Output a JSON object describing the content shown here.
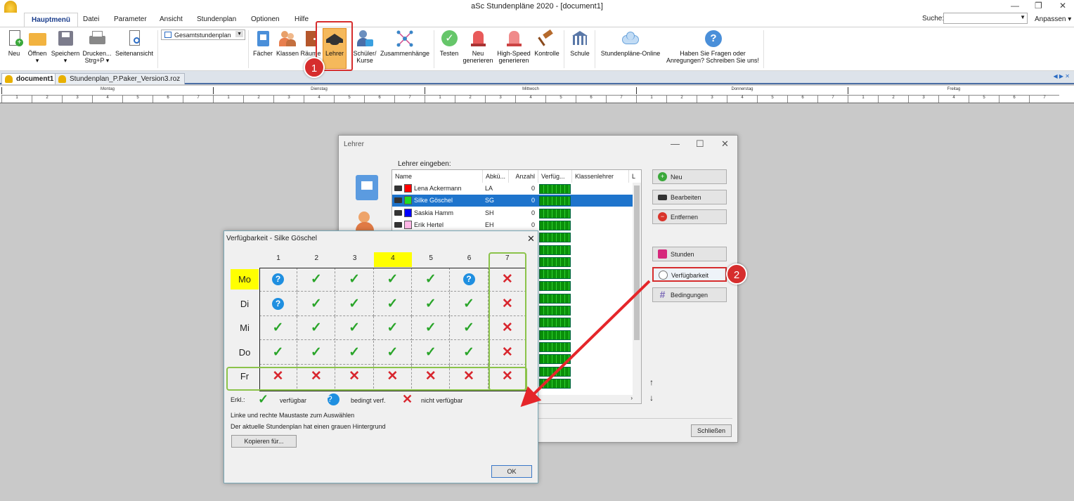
{
  "window": {
    "title": "aSc Stundenpläne 2020  - [document1]"
  },
  "menu": {
    "tabs": [
      "Hauptmenü",
      "Datei",
      "Parameter",
      "Ansicht",
      "Stundenplan",
      "Optionen",
      "Hilfe"
    ],
    "search_label": "Suche:",
    "customize": "Anpassen"
  },
  "ribbon": {
    "neu": "Neu",
    "oeffnen": "Öffnen",
    "speichern": "Speichern",
    "drucken": "Drucken...",
    "drucken2": "Strg+P",
    "seitenansicht": "Seitenansicht",
    "view_select": "Gesamtstundenplan",
    "faecher": "Fächer",
    "klassen": "Klassen",
    "raeume": "Räume",
    "lehrer": "Lehrer",
    "schueler": "Schüler/",
    "kurse": "Kurse",
    "zusammenhaenge": "Zusammenhänge",
    "testen": "Testen",
    "neu_gen": "Neu",
    "neu_gen2": "generieren",
    "highspeed": "High-Speed",
    "highspeed2": "generieren",
    "kontrolle": "Kontrolle",
    "schule": "Schule",
    "online": "Stundenpläne-Online",
    "fragen": "Haben Sie Fragen oder",
    "fragen2": "Anregungen? Schreiben Sie uns!"
  },
  "doc_tabs": [
    "document1",
    "Stundenplan_P.Paker_Version3.roz"
  ],
  "timetable": {
    "days": [
      "Montag",
      "Dienstag",
      "Mittwoch",
      "Donnerstag",
      "Freitag"
    ],
    "periods": [
      "1",
      "2",
      "3",
      "4",
      "5",
      "6",
      "7"
    ]
  },
  "lehrer_dialog": {
    "title": "Lehrer",
    "label": "Lehrer eingeben:",
    "columns": [
      "Name",
      "Abkü...",
      "Anzahl",
      "Verfüg...",
      "Klassenlehrer",
      "L"
    ],
    "rows": [
      {
        "name": "Lena Ackermann",
        "abbr": "LA",
        "count": "0",
        "color": "#ff0000"
      },
      {
        "name": "Silke Göschel",
        "abbr": "SG",
        "count": "0",
        "color": "#22dd22"
      },
      {
        "name": "Saskia Hamm",
        "abbr": "SH",
        "count": "0",
        "color": "#0000ff"
      },
      {
        "name": "Erik Hertel",
        "abbr": "EH",
        "count": "0",
        "color": "#ffb6e6"
      }
    ],
    "buttons": {
      "neu": "Neu",
      "bearbeiten": "Bearbeiten",
      "entfernen": "Entfernen",
      "stunden": "Stunden",
      "verfuegbarkeit": "Verfügbarkeit",
      "bedingungen": "Bedingungen",
      "schliessen": "Schließen"
    }
  },
  "verf_dialog": {
    "title": "Verfügbarkeit - Silke Göschel",
    "periods": [
      "1",
      "2",
      "3",
      "4",
      "5",
      "6",
      "7"
    ],
    "days": [
      "Mo",
      "Di",
      "Mi",
      "Do",
      "Fr"
    ],
    "grid": [
      [
        "q",
        "ok",
        "ok",
        "ok",
        "ok",
        "q",
        "no"
      ],
      [
        "q",
        "ok",
        "ok",
        "ok",
        "ok",
        "ok",
        "no"
      ],
      [
        "ok",
        "ok",
        "ok",
        "ok",
        "ok",
        "ok",
        "no"
      ],
      [
        "ok",
        "ok",
        "ok",
        "ok",
        "ok",
        "ok",
        "no"
      ],
      [
        "no",
        "no",
        "no",
        "no",
        "no",
        "no",
        "no"
      ]
    ],
    "legend": {
      "label": "Erkl.:",
      "ok": "verfügbar",
      "q": "bedingt verf.",
      "no": "nicht verfügbar"
    },
    "hint1": "Linke und rechte Maustaste zum Auswählen",
    "hint2": "Der aktuelle Stundenplan hat einen grauen Hintergrund",
    "copy_btn": "Kopieren für...",
    "ok_btn": "OK"
  },
  "markers": {
    "m1": "1",
    "m2": "2"
  },
  "colors": {
    "highlight": "#ffff00",
    "selection": "#1e74cc",
    "annotation": "#d62d2d",
    "frame": "#8bc34a"
  }
}
